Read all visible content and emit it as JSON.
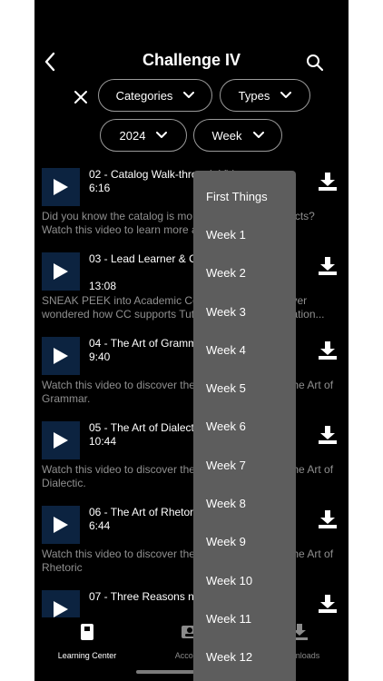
{
  "header": {
    "title": "Challenge IV"
  },
  "filters": {
    "categories_label": "Categories",
    "types_label": "Types",
    "year_label": "2024",
    "week_label": "Week"
  },
  "videos": [
    {
      "title": "02 - Catalog Walk-through Video",
      "duration": "6:16",
      "description": "Did you know the catalog is more than a list of products? Watch this video to learn more about"
    },
    {
      "title": "03 - Lead Learner & Christian Worldview",
      "duration": "13:08",
      "description": "SNEAK PEEK into Academic Coaching! Have you ever wondered how CC supports Tutors in classical education..."
    },
    {
      "title": "04 - The Art of Grammar",
      "duration": "9:40",
      "description": "Watch this video to discover the history and how of the Art of Grammar."
    },
    {
      "title": "05 - The Art of Dialectic",
      "duration": "10:44",
      "description": "Watch this video to discover the history and how of the Art of Dialectic."
    },
    {
      "title": "06 - The Art of Rhetoric",
      "duration": "6:44",
      "description": "Watch this video to discover the history and how of the Art of Rhetoric"
    },
    {
      "title": "07 - Three Reasons normal people, not la",
      "duration": "",
      "description": ""
    }
  ],
  "dropdown": {
    "options": [
      "First Things",
      "Week 1",
      "Week 2",
      "Week 3",
      "Week 4",
      "Week 5",
      "Week 6",
      "Week 7",
      "Week 8",
      "Week 9",
      "Week 10",
      "Week 11",
      "Week 12"
    ]
  },
  "tabbar": {
    "learning_center": "Learning Center",
    "account": "Account",
    "downloads": "Downloads"
  },
  "colors": {
    "background": "#000000",
    "thumbnail": "#0c2340",
    "dropdown": "#5d5d5d",
    "description_text": "#8f8f8f"
  }
}
